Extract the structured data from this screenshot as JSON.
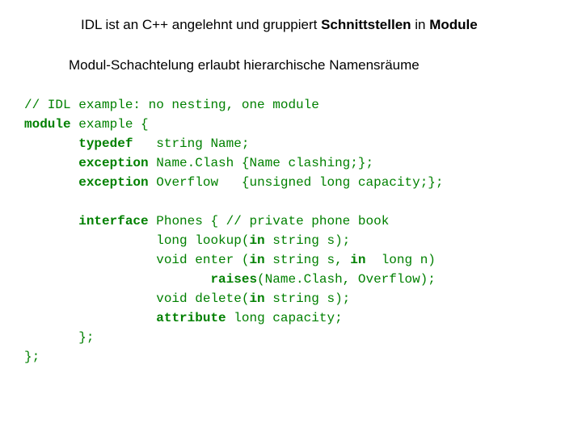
{
  "heading": {
    "part1": "IDL ist an C++ angelehnt und gruppiert ",
    "bold1": "Schnittstellen",
    "part2": " in ",
    "bold2": "Module"
  },
  "subheading": "Modul-Schachtelung erlaubt hierarchische Namensräume",
  "code": {
    "l1a": "// IDL example: no nesting, one module",
    "l2_kw": "module",
    "l2_rest": " example {",
    "l3_pad": "       ",
    "l3_kw": "typedef",
    "l3_rest": "   string Name;",
    "l4_pad": "       ",
    "l4_kw": "exception",
    "l4_rest": " Name.Clash {Name clashing;};",
    "l5_pad": "       ",
    "l5_kw": "exception",
    "l5_rest": " Overflow   {unsigned long capacity;};",
    "blank": "",
    "l6_pad": "       ",
    "l6_kw": "interface",
    "l6_rest": " Phones { // private phone book",
    "l7": "                 long lookup(",
    "l7_kw": "in",
    "l7_rest": " string s);",
    "l8": "                 void enter (",
    "l8_kw1": "in",
    "l8_mid": " string s, ",
    "l8_kw2": "in",
    "l8_rest": "  long n)",
    "l9_pad": "                        ",
    "l9_kw": "raises",
    "l9_rest": "(Name.Clash, Overflow);",
    "l10": "                 void delete(",
    "l10_kw": "in",
    "l10_rest": " string s);",
    "l11_pad": "                 ",
    "l11_kw": "attribute",
    "l11_rest": " long capacity;",
    "l12": "       };",
    "l13": "};"
  }
}
